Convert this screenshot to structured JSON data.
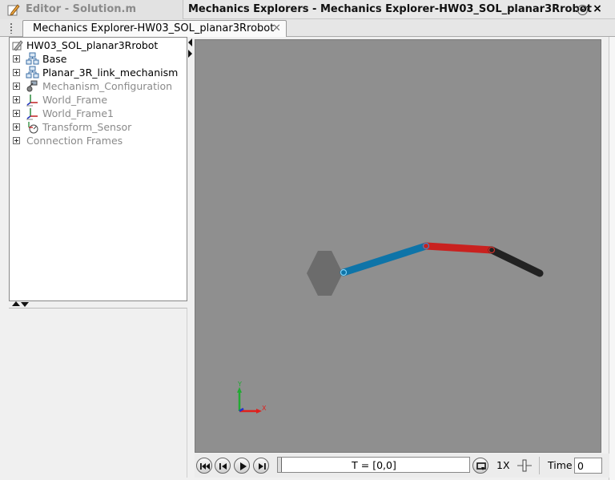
{
  "titlebar": {
    "editor_title": "Editor - Solution.m",
    "explorer_title": "Mechanics Explorers - Mechanics Explorer-HW03_SOL_planar3Rrobot",
    "close_glyph": "×",
    "menu_glyph": "▾"
  },
  "tabs": [
    {
      "label": "Mechanics Explorer-HW03_SOL_planar3Rrobot",
      "close_glyph": "✕",
      "active": true
    }
  ],
  "tree": {
    "root": {
      "label": "HW03_SOL_planar3Rrobot",
      "icon": "model-icon"
    },
    "items": [
      {
        "label": "Base",
        "icon": "subsystem-icon",
        "enabled": true
      },
      {
        "label": "Planar_3R_link_mechanism",
        "icon": "subsystem-icon",
        "enabled": true
      },
      {
        "label": "Mechanism_Configuration",
        "icon": "mechanism-config-icon",
        "enabled": false
      },
      {
        "label": "World_Frame",
        "icon": "frame-icon",
        "enabled": false
      },
      {
        "label": "World_Frame1",
        "icon": "frame-icon",
        "enabled": false
      },
      {
        "label": "Transform_Sensor",
        "icon": "transform-sensor-icon",
        "enabled": false
      },
      {
        "label": "Connection Frames",
        "icon": "",
        "enabled": false
      }
    ]
  },
  "viewport": {
    "background": "#8f8f8f",
    "base_color": "#6c6c6c",
    "link_colors": [
      "#0e74a8",
      "#c9211f",
      "#222222"
    ],
    "triad": {
      "x_label": "X",
      "y_label": "Y",
      "x_color": "#e0201c",
      "y_color": "#22aa33",
      "z_color": "#2233cc"
    }
  },
  "playback": {
    "time_range": "T = [0,0]",
    "speed": "1X",
    "time_label": "Time",
    "time_value": "0"
  }
}
